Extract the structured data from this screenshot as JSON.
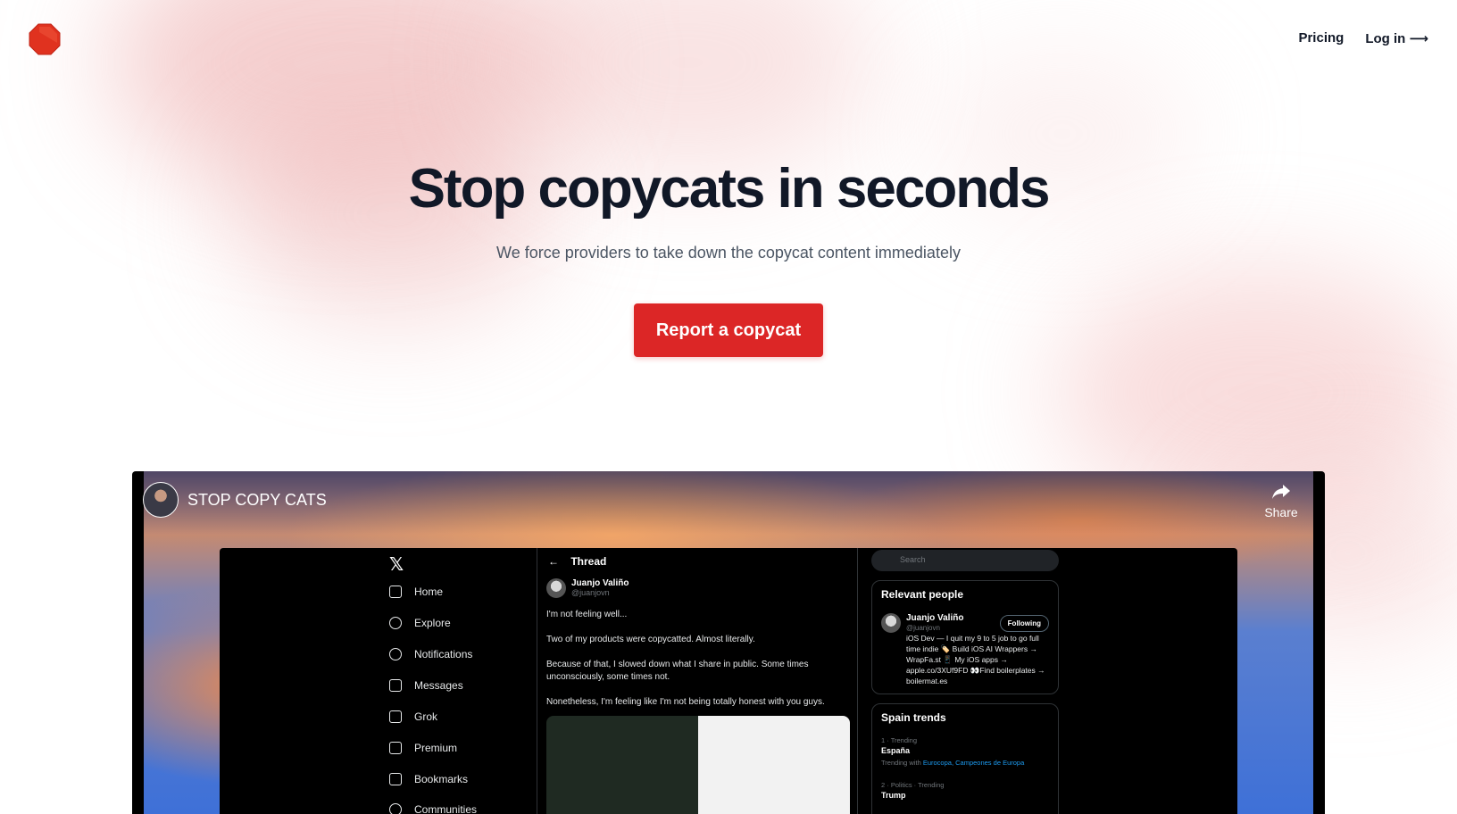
{
  "nav": {
    "pricing": "Pricing",
    "login": "Log in ⟶"
  },
  "hero": {
    "title": "Stop copycats in seconds",
    "subtitle": "We force providers to take down the copycat content immediately",
    "cta": "Report a copycat"
  },
  "video": {
    "title": "STOP COPY CATS",
    "share": "Share",
    "x": {
      "nav": [
        "Home",
        "Explore",
        "Notifications",
        "Messages",
        "Grok",
        "Premium",
        "Bookmarks",
        "Communities"
      ],
      "thread_title": "Thread",
      "author_name": "Juanjo Valiño",
      "author_handle": "@juanjovn",
      "tweet_lines": [
        "I'm not feeling well...",
        "Two of my products were copycatted. Almost literally.",
        "Because of that, I slowed down what I share in public. Some times unconsciously, some times not.",
        "Nonetheless, I'm feeling like I'm not being totally honest with you guys."
      ],
      "search_placeholder": "Search",
      "relevant_title": "Relevant people",
      "following": "Following",
      "bio": "iOS Dev — I quit my 9 to 5 job to go full time indie 🏷️ Build iOS AI Wrappers → WrapFa.st 📱 My iOS apps → apple.co/3XUf9FD 👀Find boilerplates → boilermat.es",
      "trends_title": "Spain trends",
      "trends": [
        {
          "meta": "1 · Trending",
          "name": "España",
          "with_label": "Trending with",
          "with": "Eurocopa, Campeones de Europa"
        },
        {
          "meta": "2 · Politics · Trending",
          "name": "Trump"
        }
      ]
    }
  },
  "colors": {
    "accent": "#dc2626",
    "text": "#111827",
    "muted": "#4b5563"
  }
}
